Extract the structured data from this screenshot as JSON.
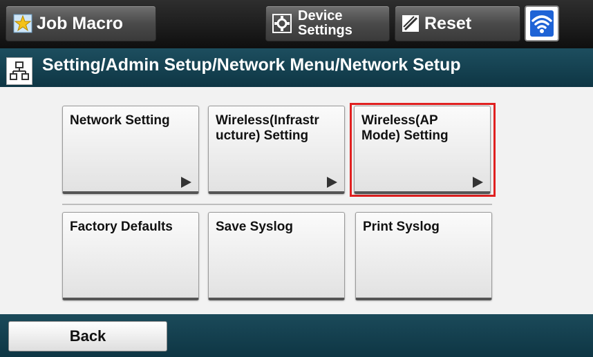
{
  "toolbar": {
    "job_macro_label": "Job Macro",
    "device_settings_line1": "Device",
    "device_settings_line2": "Settings",
    "reset_label": "Reset",
    "icons": {
      "job_macro": "star-icon",
      "device_settings": "device-settings-icon",
      "reset": "reset-icon",
      "wifi": "wifi-icon"
    }
  },
  "breadcrumb": {
    "text": "Setting/Admin Setup/Network Menu/Network Setup",
    "icon": "network-icon"
  },
  "menu": {
    "row1": [
      {
        "label": "Network Setting",
        "has_submenu": true
      },
      {
        "label": "Wireless(Infrastr\nucture) Setting",
        "has_submenu": true
      },
      {
        "label": "Wireless(AP\nMode) Setting",
        "has_submenu": true,
        "highlighted": true
      }
    ],
    "row2": [
      {
        "label": "Factory Defaults"
      },
      {
        "label": "Save Syslog"
      },
      {
        "label": "Print Syslog"
      }
    ]
  },
  "footer": {
    "back_label": "Back"
  },
  "colors": {
    "header_bg": "#1a1a1a",
    "crumb_bg": "#12404f",
    "highlight": "#e02020",
    "wifi_blue": "#1e63d6"
  }
}
